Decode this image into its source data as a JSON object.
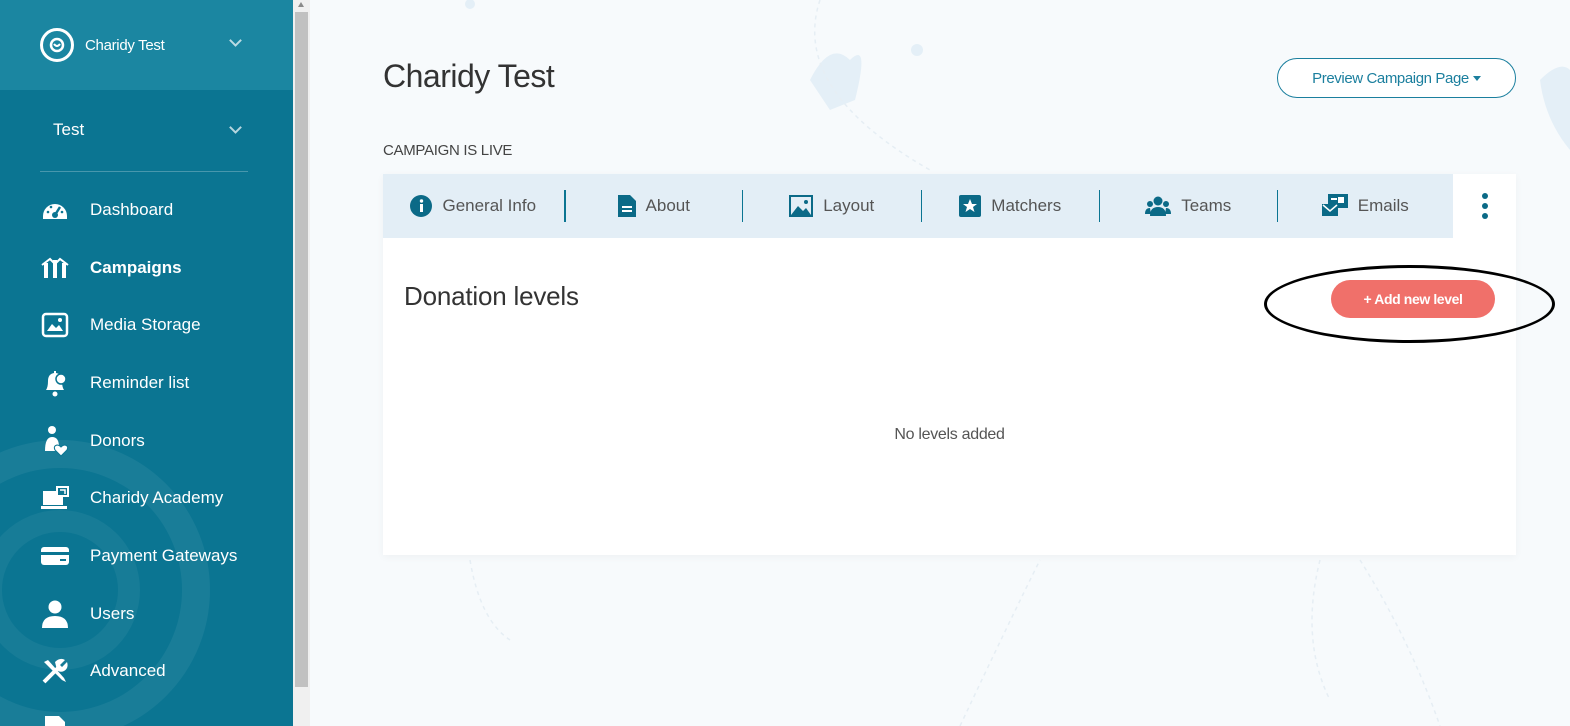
{
  "sidebar": {
    "org_name": "Charidy Test",
    "campaign_name": "Test",
    "nav": [
      {
        "label": "Dashboard",
        "icon": "dashboard-icon"
      },
      {
        "label": "Campaigns",
        "icon": "campaigns-icon",
        "active": true
      },
      {
        "label": "Media Storage",
        "icon": "media-icon"
      },
      {
        "label": "Reminder list",
        "icon": "bell-icon"
      },
      {
        "label": "Donors",
        "icon": "donors-icon"
      },
      {
        "label": "Charidy Academy",
        "icon": "academy-icon"
      },
      {
        "label": "Payment Gateways",
        "icon": "card-icon"
      },
      {
        "label": "Users",
        "icon": "user-icon"
      },
      {
        "label": "Advanced",
        "icon": "tools-icon"
      }
    ]
  },
  "header": {
    "title": "Charidy Test",
    "preview_button": "Preview Campaign Page",
    "status": "CAMPAIGN IS LIVE"
  },
  "tabs": [
    {
      "label": "General Info",
      "icon": "info-icon"
    },
    {
      "label": "About",
      "icon": "document-icon"
    },
    {
      "label": "Layout",
      "icon": "image-icon"
    },
    {
      "label": "Matchers",
      "icon": "star-icon"
    },
    {
      "label": "Teams",
      "icon": "team-icon"
    },
    {
      "label": "Emails",
      "icon": "email-icon"
    }
  ],
  "section": {
    "title": "Donation levels",
    "add_button": "+ Add new level",
    "empty_message": "No levels added"
  },
  "colors": {
    "sidebar": "#0b7592",
    "accent": "#1b7f9e",
    "add_button": "#f0706a",
    "tab_bar": "#e3eef6"
  }
}
